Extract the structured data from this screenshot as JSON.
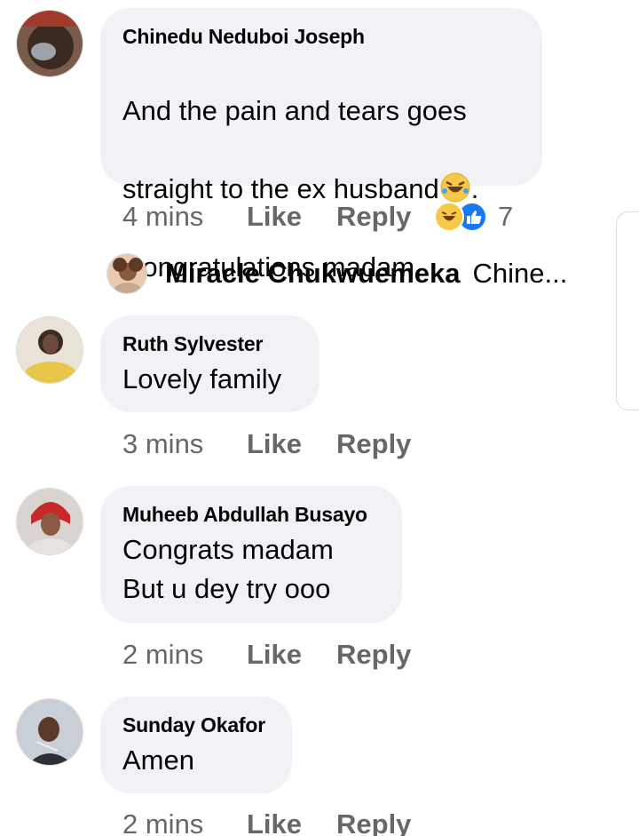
{
  "comments": [
    {
      "author": "Chinedu Neduboi Joseph",
      "text_line1": "And the pain and tears goes",
      "text_line2": "straight to the ex husband",
      "text_line2_suffix": ".",
      "text_line3": "Congratulations madam.",
      "time": "4 mins",
      "like": "Like",
      "reply": "Reply",
      "reaction_count": "7",
      "reactions": [
        "haha-icon",
        "like-icon"
      ],
      "emoji": "rolling-laughing-emoji"
    },
    {
      "author": "Ruth Sylvester",
      "text": "Lovely family",
      "time": "3 mins",
      "like": "Like",
      "reply": "Reply"
    },
    {
      "author": "Muheeb Abdullah Busayo",
      "text": "Congrats madam\nBut u dey try ooo",
      "time": "2 mins",
      "like": "Like",
      "reply": "Reply"
    },
    {
      "author": "Sunday Okafor",
      "text": "Amen",
      "time": "2 mins",
      "like": "Like",
      "reply": "Reply"
    }
  ],
  "reply_preview": {
    "author": "Miracle Chukwuemeka",
    "snippet": "Chine..."
  },
  "colors": {
    "bubble": "#f0f2f5",
    "meta_text": "#65676b",
    "like_blue": "#1877f2",
    "haha_yellow": "#f7c946"
  }
}
